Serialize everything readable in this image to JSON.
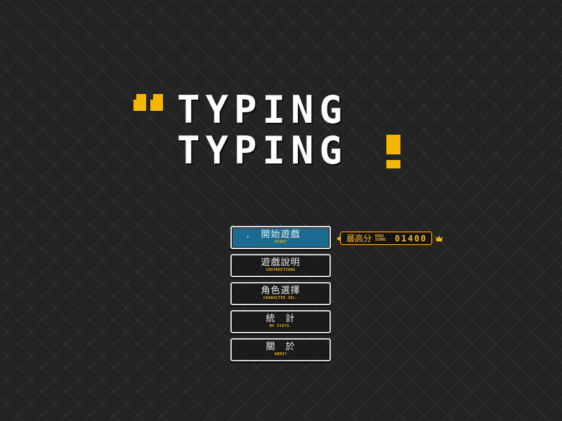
{
  "game": {
    "title_line1": "TYPING",
    "title_line2": "TYPING",
    "accent_color": "#f5b800",
    "selected_color": "#1a6a92",
    "background_color": "#232323",
    "title_icons": [
      "quote-mark-icon",
      "exclamation-icon"
    ]
  },
  "menu": {
    "items": [
      {
        "zh": "開始遊戲",
        "en": "START",
        "selected": true,
        "marker": "›"
      },
      {
        "zh": "遊戲說明",
        "en": "INSTRUCTIONS",
        "selected": false
      },
      {
        "zh": "角色選擇",
        "en": "CHARACTER SEL.",
        "selected": false
      },
      {
        "zh": "統　計",
        "en": "MY STATS.",
        "selected": false
      },
      {
        "zh": "關　於",
        "en": "ABOUT",
        "selected": false
      }
    ]
  },
  "high_score": {
    "label_zh": "最高分",
    "label_en_1": "HIGH",
    "label_en_2": "SCORE",
    "value": "01400",
    "icon": "crown-icon"
  }
}
